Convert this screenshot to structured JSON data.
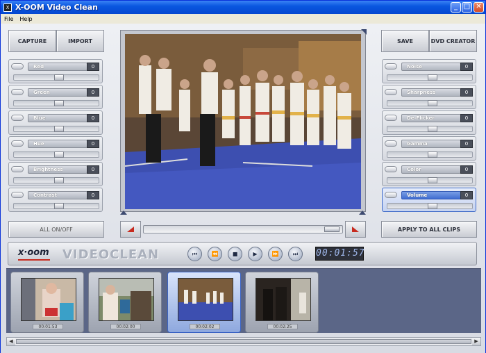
{
  "window": {
    "title": "X-OOM Video Clean",
    "icon_label": "X"
  },
  "menu": [
    "File",
    "Help"
  ],
  "left_buttons": {
    "capture": "CAPTURE",
    "import": "IMPORT",
    "all_on_off": "ALL ON/OFF"
  },
  "right_buttons": {
    "save": "SAVE",
    "dvd_creator": "DVD CREATOR",
    "apply_all": "APPLY TO ALL CLIPS"
  },
  "left_controls": [
    {
      "label": "Red",
      "value": "0"
    },
    {
      "label": "Green",
      "value": "0"
    },
    {
      "label": "Blue",
      "value": "0"
    },
    {
      "label": "Hue",
      "value": "0"
    },
    {
      "label": "Brightness",
      "value": "0"
    },
    {
      "label": "Contrast",
      "value": "0"
    }
  ],
  "right_controls": [
    {
      "label": "Noise",
      "value": "0"
    },
    {
      "label": "Sharpness",
      "value": "0"
    },
    {
      "label": "De-Flicker",
      "value": "0"
    },
    {
      "label": "Gamma",
      "value": "0"
    },
    {
      "label": "Color",
      "value": "0"
    },
    {
      "label": "Volume",
      "value": "0"
    }
  ],
  "brand": {
    "logo": "x·oom",
    "product": "VIDEOCLEAN"
  },
  "transport": {
    "timecode": "00:01:57"
  },
  "clips": [
    {
      "duration": "00:01:53",
      "selected": false
    },
    {
      "duration": "00:02:00",
      "selected": false
    },
    {
      "duration": "00:02:02",
      "selected": true
    },
    {
      "duration": "00:02:25",
      "selected": false
    }
  ],
  "colors": {
    "accent": "#0a57e0",
    "clip_bar": "#5b6687",
    "timecode_text": "#9fb7ea"
  }
}
